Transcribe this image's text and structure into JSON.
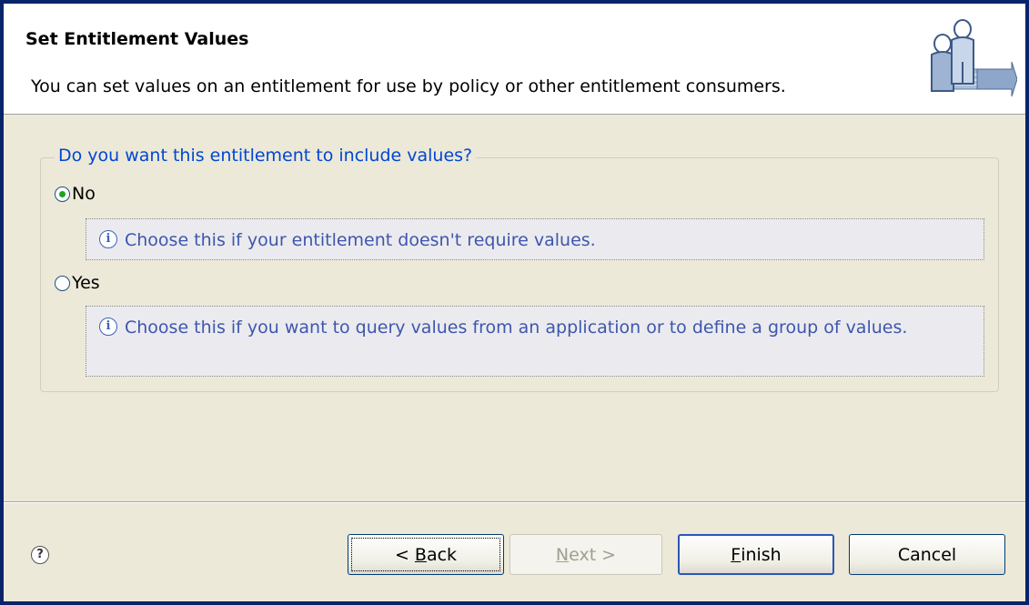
{
  "banner": {
    "title": "Set Entitlement Values",
    "description": "You can set values on an entitlement for use by policy or other entitlement consumers.",
    "icon": "users-arrow-icon"
  },
  "group": {
    "legend": "Do you want this entitlement to include values?",
    "options": [
      {
        "label": "No",
        "selected": true,
        "info": "Choose this if your entitlement doesn't require values."
      },
      {
        "label": "Yes",
        "selected": false,
        "info": "Choose this if you want to query values from an application or to define a group of values."
      }
    ]
  },
  "footer": {
    "help_icon": "help-icon",
    "back": {
      "prefix": "< ",
      "mnemonic": "B",
      "rest": "ack"
    },
    "next": {
      "mnemonic": "N",
      "rest": "ext >"
    },
    "finish": {
      "mnemonic": "F",
      "rest": "inish"
    },
    "cancel": "Cancel"
  }
}
